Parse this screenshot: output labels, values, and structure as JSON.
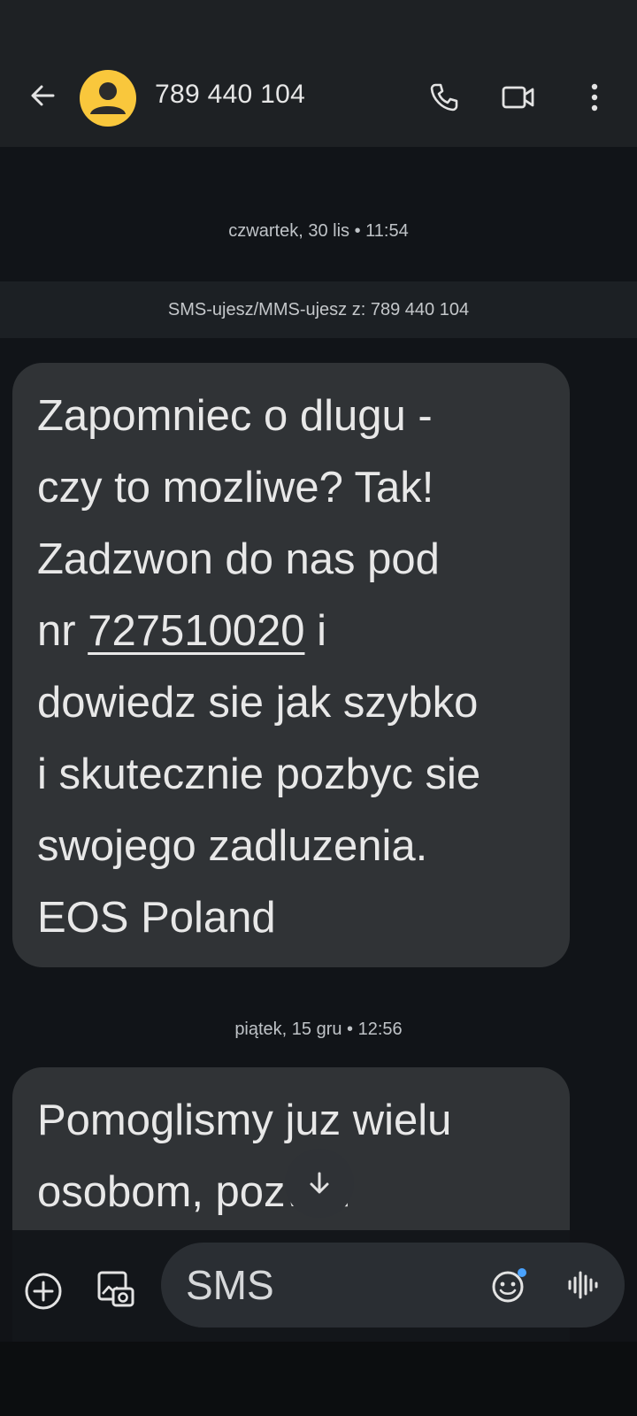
{
  "header": {
    "contact_number": "789 440 104",
    "icons": [
      "back-arrow-icon",
      "person-icon",
      "phone-icon",
      "video-camera-icon",
      "more-vert-icon"
    ],
    "avatar_color": "#f9c73c"
  },
  "conversation": {
    "date1": "czwartek, 30 lis • 11:54",
    "sim_info": "SMS-ujesz/MMS-ujesz z: 789 440 104",
    "message1": {
      "lines": [
        "Zapomniec o dlugu -",
        "czy to mozliwe? Tak!",
        "Zadzwon do nas pod",
        "nr ",
        "727510020",
        " i",
        "dowiedz sie jak szybko",
        "i skutecznie pozbyc sie",
        "swojego zadluzenia.",
        "EOS Poland"
      ]
    },
    "date2": "piątek, 15 gru • 12:56",
    "message2": {
      "lines": [
        "Pomoglismy juz wielu",
        "osobom, pozwol"
      ]
    }
  },
  "compose": {
    "placeholder": "SMS",
    "icons": [
      "add-circle-icon",
      "gallery-icon",
      "emoji-icon",
      "voice-waveform-icon"
    ]
  },
  "colors": {
    "background": "#111418",
    "topbar": "#1e2124",
    "bubble": "#303336",
    "accent": "#4aa3ff"
  }
}
